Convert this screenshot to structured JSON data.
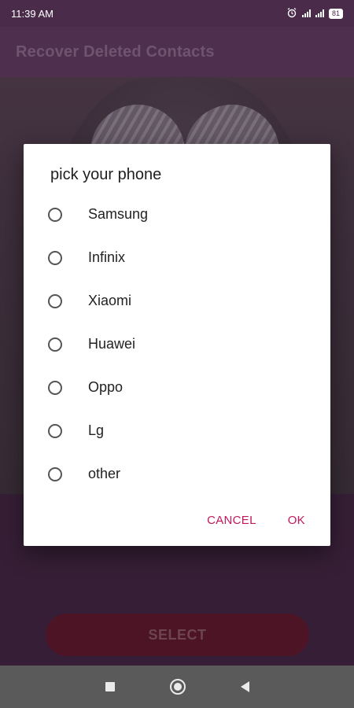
{
  "status_bar": {
    "time": "11:39 AM",
    "battery": "81",
    "icons": [
      "alarm-icon",
      "signal-icon",
      "signal-icon",
      "battery-icon"
    ]
  },
  "app_bar": {
    "title": "Recover Deleted Contacts"
  },
  "dialog": {
    "title": "pick your phone",
    "options": [
      {
        "label": "Samsung"
      },
      {
        "label": "Infinix"
      },
      {
        "label": "Xiaomi"
      },
      {
        "label": "Huawei"
      },
      {
        "label": "Oppo"
      },
      {
        "label": "Lg"
      },
      {
        "label": "other"
      }
    ],
    "cancel_label": "CANCEL",
    "ok_label": "OK",
    "accent_color": "#c2185b"
  },
  "main": {
    "select_label": "SELECT"
  },
  "nav_bar": {
    "icons": [
      "recents-icon",
      "home-icon",
      "back-icon"
    ]
  }
}
